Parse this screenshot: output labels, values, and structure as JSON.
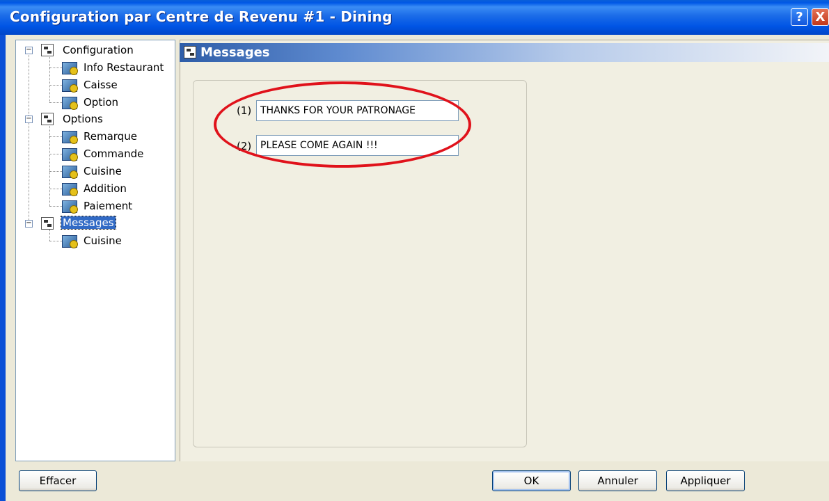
{
  "window": {
    "title": "Configuration par Centre de Revenu #1 - Dining",
    "help_label": "?",
    "close_label": "X"
  },
  "tree": {
    "nodes": [
      {
        "label": "Configuration"
      },
      {
        "label": "Info Restaurant"
      },
      {
        "label": "Caisse"
      },
      {
        "label": "Option"
      },
      {
        "label": "Options"
      },
      {
        "label": "Remarque"
      },
      {
        "label": "Commande"
      },
      {
        "label": "Cuisine"
      },
      {
        "label": "Addition"
      },
      {
        "label": "Paiement"
      },
      {
        "label": "Messages"
      },
      {
        "label": "Cuisine"
      }
    ],
    "selected": "Messages"
  },
  "panel": {
    "title": "Messages",
    "messages": [
      {
        "label": "(1)",
        "value": "THANKS FOR YOUR PATRONAGE"
      },
      {
        "label": "(2)",
        "value": "PLEASE COME AGAIN !!!"
      }
    ]
  },
  "buttons": {
    "clear": "Effacer",
    "ok": "OK",
    "cancel": "Annuler",
    "apply": "Appliquer"
  },
  "colors": {
    "annotation": "#e0121b",
    "selection": "#316ac5"
  }
}
